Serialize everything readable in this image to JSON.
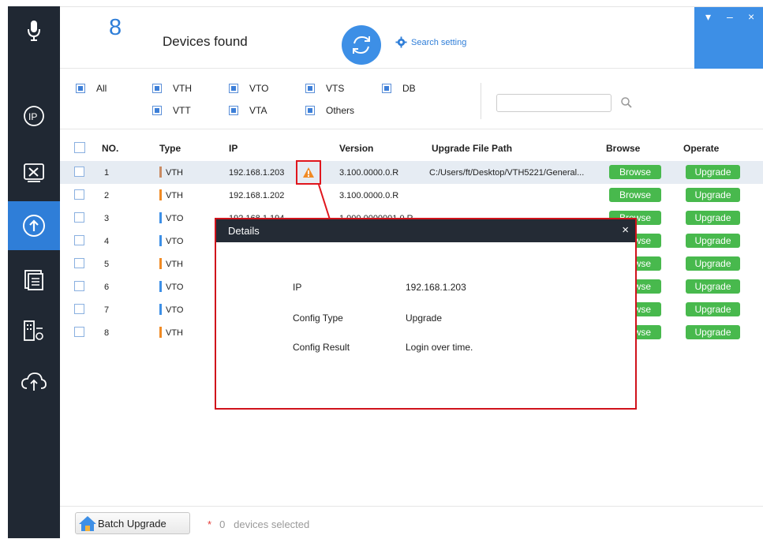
{
  "header": {
    "device_count": "8",
    "devices_found_label": "Devices found",
    "search_setting_label": "Search setting",
    "window_controls": [
      "▾",
      "–",
      "×"
    ]
  },
  "sidebar": {
    "icons": [
      "microphone-icon",
      "ip-icon",
      "tools-icon",
      "upgrade-icon",
      "config-list-icon",
      "building-settings-icon",
      "cloud-upload-icon"
    ],
    "active_index": 3
  },
  "filters": {
    "all": "All",
    "items": [
      "VTH",
      "VTO",
      "VTS",
      "DB",
      "VTT",
      "VTA",
      "Others"
    ],
    "search_value": ""
  },
  "table": {
    "headers": [
      "NO.",
      "Type",
      "IP",
      "Version",
      "Upgrade File Path",
      "Browse",
      "Operate"
    ],
    "rows": [
      {
        "no": "1",
        "type": "VTH",
        "ip": "192.168.1.203",
        "version": "3.100.0000.0.R",
        "path": "C:/Users/ft/Desktop/VTH5221/General...",
        "browse": "Browse",
        "operate": "Upgrade"
      },
      {
        "no": "2",
        "type": "VTH",
        "ip": "192.168.1.202",
        "version": "3.100.0000.0.R",
        "path": "",
        "browse": "Browse",
        "operate": "Upgrade"
      },
      {
        "no": "3",
        "type": "VTO",
        "ip": "192.168.1.194",
        "version": "1.000.0000001.0.R",
        "path": "",
        "browse": "Browse",
        "operate": "Upgrade"
      },
      {
        "no": "4",
        "type": "VTO",
        "ip": "",
        "version": "",
        "path": "",
        "browse": "Browse",
        "operate": "Upgrade"
      },
      {
        "no": "5",
        "type": "VTH",
        "ip": "",
        "version": "",
        "path": "",
        "browse": "Browse",
        "operate": "Upgrade"
      },
      {
        "no": "6",
        "type": "VTO",
        "ip": "",
        "version": "",
        "path": "",
        "browse": "Browse",
        "operate": "Upgrade"
      },
      {
        "no": "7",
        "type": "VTO",
        "ip": "",
        "version": "",
        "path": "",
        "browse": "Browse",
        "operate": "Upgrade"
      },
      {
        "no": "8",
        "type": "VTH",
        "ip": "",
        "version": "",
        "path": "",
        "browse": "Browse",
        "operate": "Upgrade"
      }
    ]
  },
  "colors": {
    "vth": "#f08a24",
    "vto": "#3d8fe6",
    "accent": "#2f7ed8",
    "green": "#48b94d",
    "highlight": "#e0161d"
  },
  "dialog": {
    "title": "Details",
    "close": "×",
    "ip_label": "IP",
    "ip_value": "192.168.1.203",
    "config_type_label": "Config Type",
    "config_type_value": "Upgrade",
    "config_result_label": "Config Result",
    "config_result_value": "Login over time."
  },
  "footer": {
    "batch_upgrade_label": "Batch Upgrade",
    "star": "*",
    "selected_count": "0",
    "selected_label": "devices selected"
  }
}
